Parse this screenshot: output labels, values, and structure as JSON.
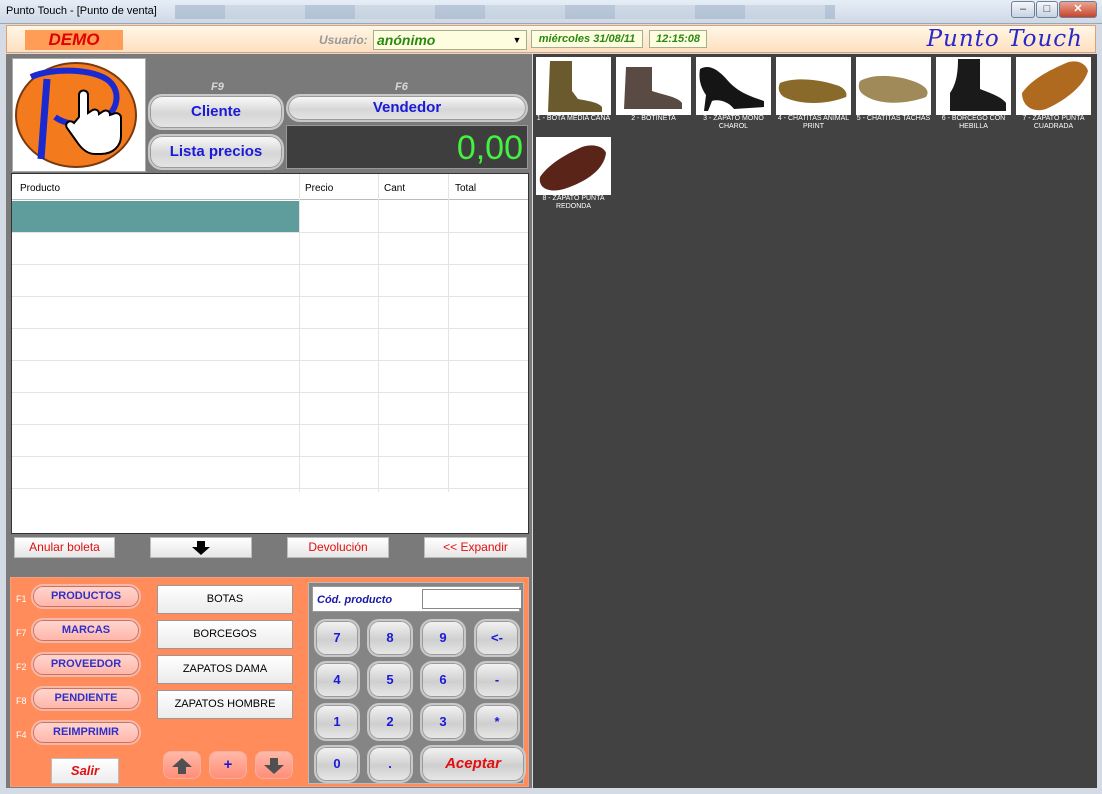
{
  "window": {
    "title": "Punto Touch - [Punto de venta]"
  },
  "topbar": {
    "demo": "DEMO",
    "user_label": "Usuario:",
    "user_value": "anónimo",
    "date": "miércoles 31/08/11",
    "time": "12:15:08",
    "brand": "Punto Touch"
  },
  "header": {
    "f9": "F9",
    "f6": "F6",
    "cliente": "Cliente",
    "vendedor": "Vendedor",
    "lista_precios": "Lista precios",
    "total": "0,00"
  },
  "table": {
    "columns": [
      "Producto",
      "Precio",
      "Cant",
      "Total"
    ],
    "rows": []
  },
  "actions": {
    "anular": "Anular boleta",
    "devolucion": "Devolución",
    "expandir": "<< Expandir"
  },
  "categories": [
    {
      "key": "F1",
      "label": "PRODUCTOS"
    },
    {
      "key": "F7",
      "label": "MARCAS"
    },
    {
      "key": "F2",
      "label": "PROVEEDOR"
    },
    {
      "key": "F8",
      "label": "PENDIENTE"
    },
    {
      "key": "F4",
      "label": "REIMPRIMIR"
    }
  ],
  "salir": "Salir",
  "subcategories": [
    "BOTAS",
    "BORCEGOS",
    "ZAPATOS DAMA",
    "ZAPATOS HOMBRE"
  ],
  "nav_plus": "+",
  "keypad": {
    "code_label": "Cód. producto",
    "code_value": "",
    "keys": [
      "7",
      "8",
      "9",
      "<-",
      "4",
      "5",
      "6",
      "-",
      "1",
      "2",
      "3",
      "*",
      "0",
      "."
    ],
    "accept": "Aceptar"
  },
  "products": [
    {
      "caption": "1 - BOTA MEDIA CAÑA",
      "color": "#6b5a2e"
    },
    {
      "caption": "2 - BOTINETA",
      "color": "#5a4a44"
    },
    {
      "caption": "3 - ZAPATO MONO CHAROL",
      "color": "#151515"
    },
    {
      "caption": "4 - CHATITAS ANIMAL PRINT",
      "color": "#8a6a2a"
    },
    {
      "caption": "5 - CHATITAS TACHAS",
      "color": "#a08a5a"
    },
    {
      "caption": "6 - BORCEGO CON HEBILLA",
      "color": "#1a1a1a"
    },
    {
      "caption": "7 - ZAPATO PUNTA CUADRADA",
      "color": "#b06a20"
    },
    {
      "caption": "8 - ZAPATO PUNTA REDONDA",
      "color": "#5a2418"
    }
  ]
}
